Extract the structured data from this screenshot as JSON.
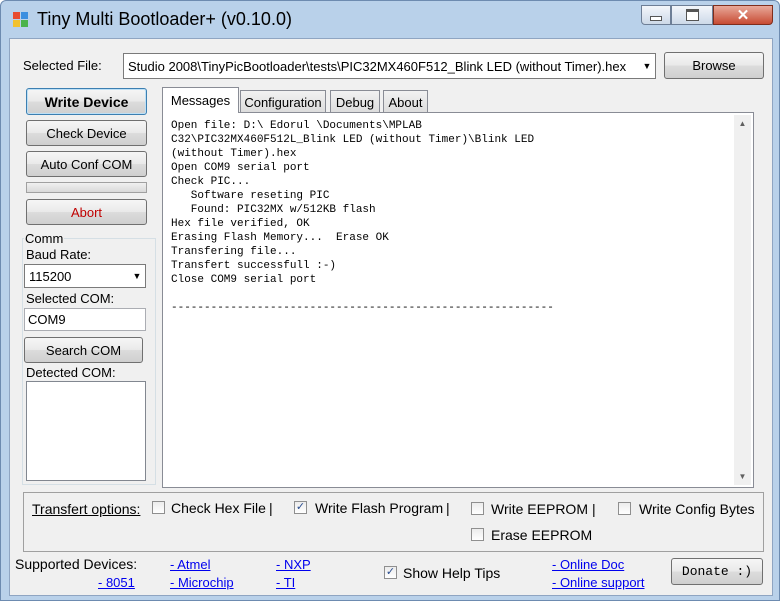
{
  "window": {
    "title": "Tiny Multi Bootloader+ (v0.10.0)"
  },
  "file": {
    "label": "Selected File:",
    "value": "Studio 2008\\TinyPicBootloader\\tests\\PIC32MX460F512_Blink LED (without Timer).hex",
    "browse_label": "Browse"
  },
  "actions": {
    "write_device": "Write Device",
    "check_device": "Check Device",
    "auto_conf_com": "Auto Conf COM",
    "abort": "Abort",
    "progress": 0
  },
  "comm": {
    "group_label": "Comm",
    "baud_label": "Baud Rate:",
    "baud_value": "115200",
    "selected_com_label": "Selected COM:",
    "selected_com_value": "COM9",
    "search_com": "Search COM",
    "detected_com_label": "Detected COM:"
  },
  "tabs": [
    {
      "label": "Messages"
    },
    {
      "label": "Configuration"
    },
    {
      "label": "Debug"
    },
    {
      "label": "About"
    }
  ],
  "log": "Open file: D:\\ Edorul \\Documents\\MPLAB\nC32\\PIC32MX460F512L_Blink LED (without Timer)\\Blink LED\n(without Timer).hex\nOpen COM9 serial port\nCheck PIC...\n   Software reseting PIC\n   Found: PIC32MX w/512KB flash\nHex file verified, OK\nErasing Flash Memory...  Erase OK\nTransfering file...\nTransfert successfull :-)\nClose COM9 serial port\n\n----------------------------------------------------------",
  "transfert": {
    "label": "Transfert options:",
    "check_hex": {
      "label": "Check Hex File",
      "checked": false
    },
    "write_flash": {
      "label": "Write Flash Program",
      "checked": true
    },
    "write_eeprom": {
      "label": "Write EEPROM",
      "checked": false
    },
    "write_config": {
      "label": "Write Config Bytes",
      "checked": false
    },
    "erase_eeprom": {
      "label": "Erase EEPROM",
      "checked": false
    },
    "sep": "|"
  },
  "footer": {
    "supported_label": "Supported Devices:",
    "links": {
      "atmel": "- Atmel",
      "nxp": "- NXP",
      "pic8051": "- 8051",
      "microchip": "- Microchip",
      "ti": "- TI",
      "online_doc": "- Online Doc",
      "online_support": "- Online support"
    },
    "help_tips": {
      "label": "Show Help Tips",
      "checked": true
    },
    "donate": "Donate :)"
  }
}
